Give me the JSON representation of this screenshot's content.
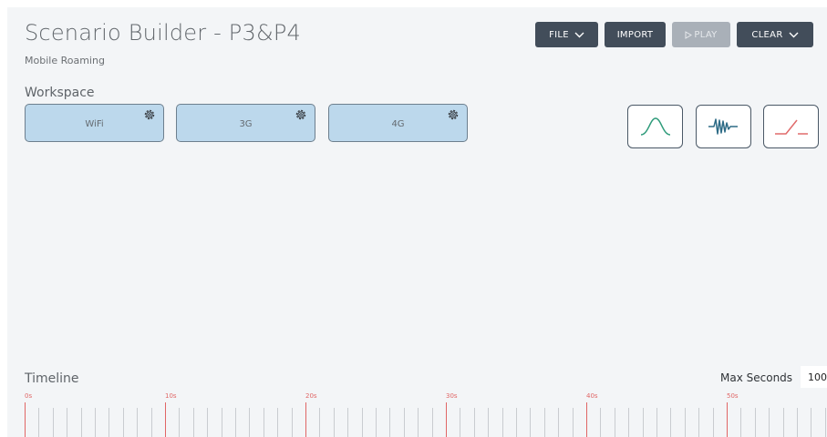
{
  "header": {
    "title": "Scenario Builder - P3&P4",
    "subtitle": "Mobile Roaming"
  },
  "toolbar": {
    "file_label": "FILE",
    "import_label": "IMPORT",
    "play_label": "PLAY",
    "clear_label": "CLEAR",
    "play_disabled": true
  },
  "workspace": {
    "label": "Workspace",
    "devices": [
      {
        "label": "WiFi"
      },
      {
        "label": "3G"
      },
      {
        "label": "4G"
      }
    ],
    "tools": [
      {
        "name": "bell-curve-icon",
        "color": "#2e9b7a"
      },
      {
        "name": "noise-wave-icon",
        "color": "#2d6b86"
      },
      {
        "name": "ramp-icon",
        "color": "#e06a6a"
      }
    ]
  },
  "timeline": {
    "label": "Timeline",
    "max_seconds_label": "Max Seconds",
    "max_seconds_value": "100",
    "ticks": [
      "0s",
      "10s",
      "20s",
      "30s",
      "40s",
      "50s"
    ]
  },
  "colors": {
    "panel_bg": "#f3f5f7",
    "button_bg": "#424d5a",
    "button_disabled_bg": "#a9b0b8",
    "device_bg": "#bcd8ec",
    "tick_major": "#e06666",
    "tick_minor": "#c9ccd0"
  }
}
